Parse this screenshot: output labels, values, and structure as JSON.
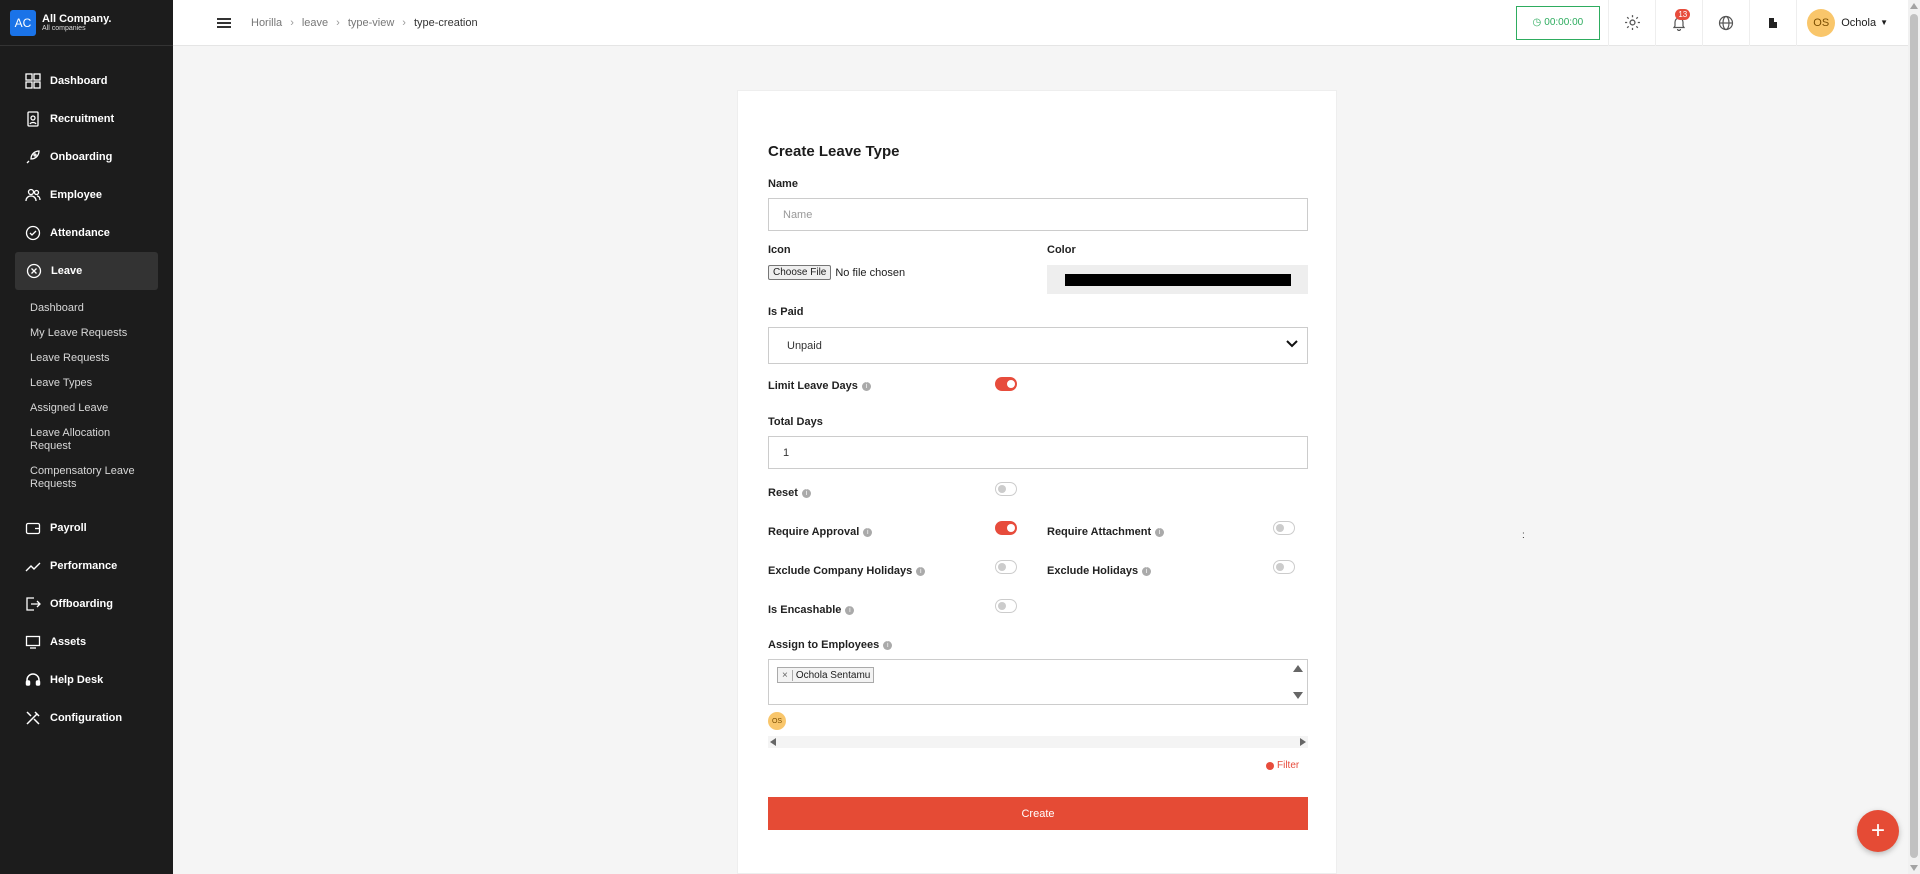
{
  "company": {
    "initials": "AC",
    "name": "All Company.",
    "subtitle": "All companies"
  },
  "sidebar": {
    "items": [
      {
        "label": "Dashboard",
        "icon": "dashboard-icon"
      },
      {
        "label": "Recruitment",
        "icon": "recruitment-icon"
      },
      {
        "label": "Onboarding",
        "icon": "rocket-icon"
      },
      {
        "label": "Employee",
        "icon": "people-icon"
      },
      {
        "label": "Attendance",
        "icon": "check-circle-icon"
      },
      {
        "label": "Leave",
        "icon": "leave-icon"
      },
      {
        "label": "Payroll",
        "icon": "wallet-icon"
      },
      {
        "label": "Performance",
        "icon": "trend-icon"
      },
      {
        "label": "Offboarding",
        "icon": "exit-icon"
      },
      {
        "label": "Assets",
        "icon": "monitor-icon"
      },
      {
        "label": "Help Desk",
        "icon": "headset-icon"
      },
      {
        "label": "Configuration",
        "icon": "tools-icon"
      }
    ],
    "leave_sub": [
      "Dashboard",
      "My Leave Requests",
      "Leave Requests",
      "Leave Types",
      "Assigned Leave",
      "Leave Allocation Request",
      "Compensatory Leave Requests"
    ]
  },
  "header": {
    "breadcrumb": [
      "Horilla",
      "leave",
      "type-view",
      "type-creation"
    ],
    "timer": "00:00:00",
    "notification_count": "13",
    "user_initials": "OS",
    "user_name": "Ochola"
  },
  "form": {
    "title": "Create Leave Type",
    "name_label": "Name",
    "name_placeholder": "Name",
    "icon_label": "Icon",
    "file_button": "Choose File",
    "file_status": "No file chosen",
    "color_label": "Color",
    "color_value": "#000000",
    "is_paid_label": "Is Paid",
    "is_paid_value": "Unpaid",
    "limit_label": "Limit Leave Days",
    "limit_on": true,
    "total_days_label": "Total Days",
    "total_days_value": "1",
    "reset_label": "Reset",
    "reset_on": false,
    "require_approval_label": "Require Approval",
    "require_approval_on": true,
    "require_attachment_label": "Require Attachment",
    "require_attachment_on": false,
    "exclude_company_holidays_label": "Exclude Company Holidays",
    "exclude_company_holidays_on": false,
    "exclude_holidays_label": "Exclude Holidays",
    "exclude_holidays_on": false,
    "is_encashable_label": "Is Encashable",
    "is_encashable_on": false,
    "assign_label": "Assign to Employees",
    "assigned": [
      "Ochola Sentamu"
    ],
    "assigned_initials": "OS",
    "filter_label": "Filter",
    "create_label": "Create"
  },
  "colors": {
    "accent": "#e54b35",
    "timer_green": "#2eac5f",
    "sidebar_bg": "#1c1c1c"
  }
}
